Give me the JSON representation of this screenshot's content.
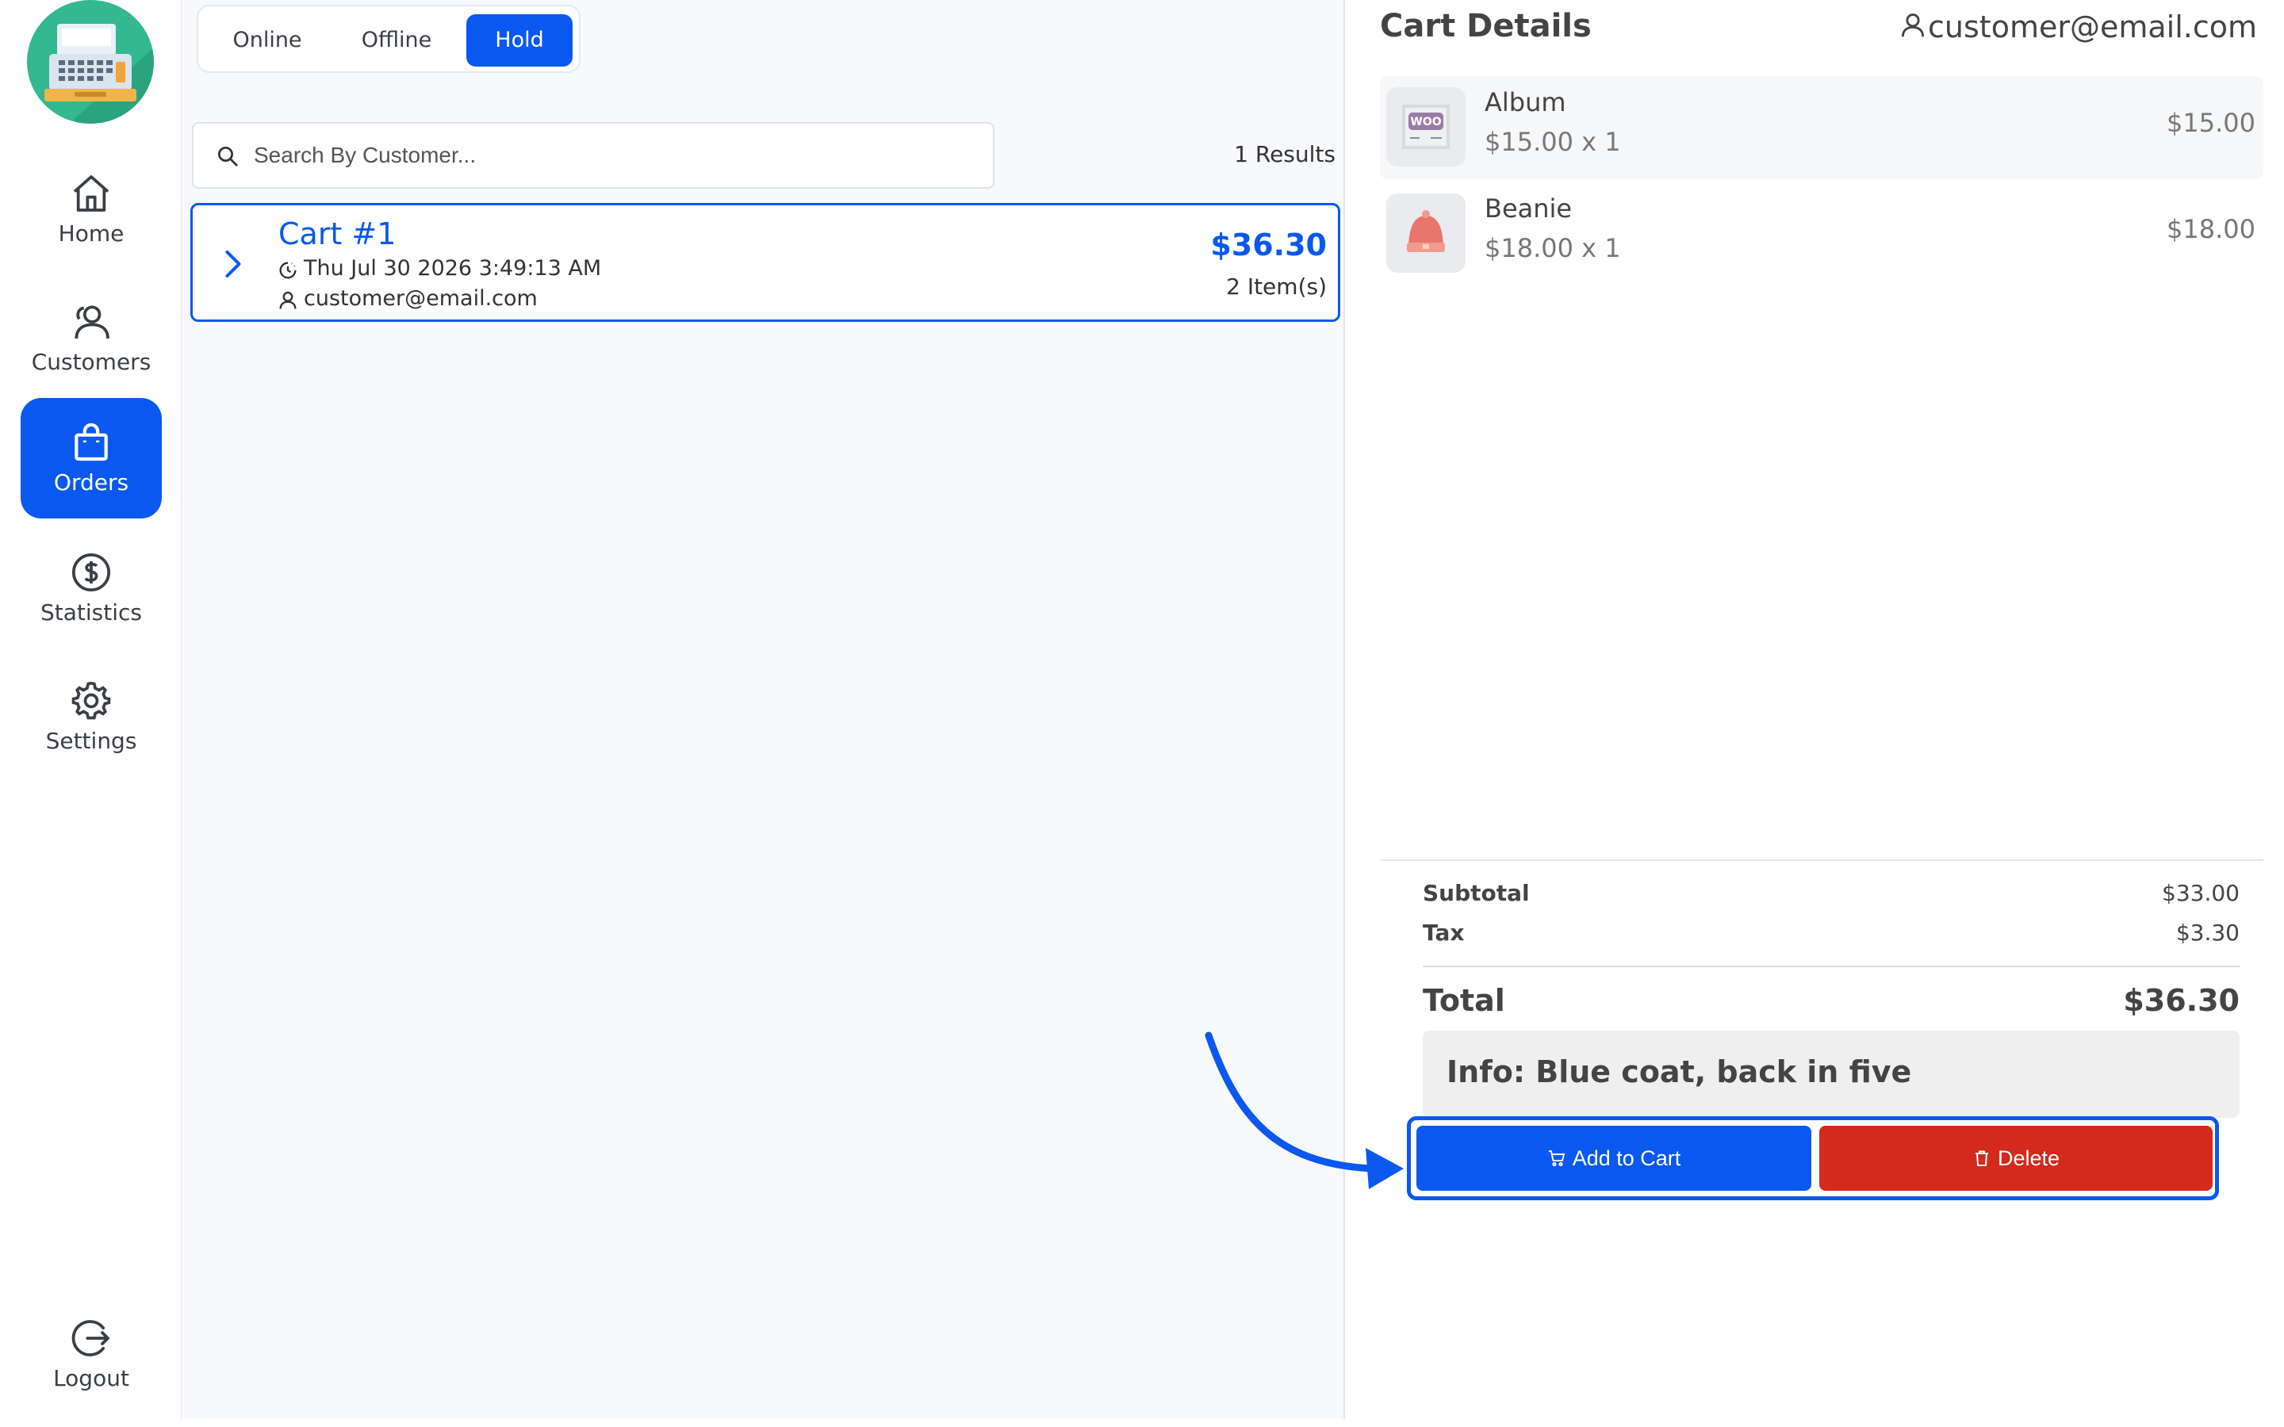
{
  "sidebar": {
    "items": [
      {
        "label": "Home",
        "icon": "home-icon",
        "active": false
      },
      {
        "label": "Customers",
        "icon": "customers-icon",
        "active": false
      },
      {
        "label": "Orders",
        "icon": "bag-icon",
        "active": true
      },
      {
        "label": "Statistics",
        "icon": "dollar-icon",
        "active": false
      },
      {
        "label": "Settings",
        "icon": "gear-icon",
        "active": false
      }
    ],
    "logout_label": "Logout"
  },
  "tabs": {
    "online": "Online",
    "offline": "Offline",
    "hold": "Hold",
    "active": "Hold"
  },
  "search": {
    "placeholder": "Search By Customer...",
    "value": "",
    "results_text": "1 Results"
  },
  "held_carts": [
    {
      "title": "Cart #1",
      "date": "Thu Jul 30 2026 3:49:13 AM",
      "customer": "customer@email.com",
      "total": "$36.30",
      "item_count": "2 Item(s)"
    }
  ],
  "cart_details": {
    "title": "Cart Details",
    "customer": "customer@email.com",
    "items": [
      {
        "name": "Album",
        "qty_line": "$15.00 x 1",
        "price": "$15.00",
        "thumb": "woo-album-thumbnail"
      },
      {
        "name": "Beanie",
        "qty_line": "$18.00 x 1",
        "price": "$18.00",
        "thumb": "beanie-thumbnail"
      }
    ],
    "subtotal_label": "Subtotal",
    "subtotal_value": "$33.00",
    "tax_label": "Tax",
    "tax_value": "$3.30",
    "total_label": "Total",
    "total_value": "$36.30",
    "note": "Info: Blue coat, back in five",
    "add_to_cart_label": "Add to Cart",
    "delete_label": "Delete"
  },
  "colors": {
    "accent": "#0a58ef",
    "danger": "#d4291d",
    "logo_bg": "#33b88f"
  }
}
